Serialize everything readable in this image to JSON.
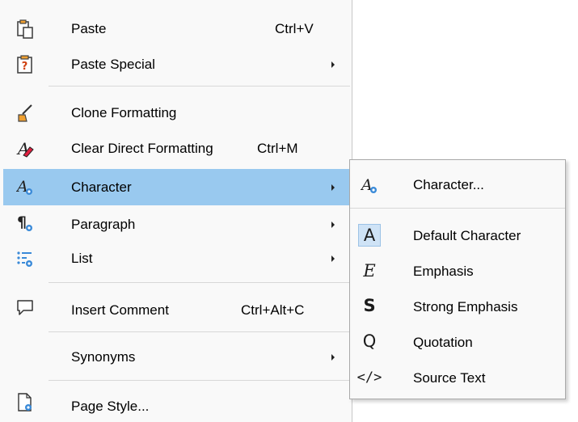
{
  "context_menu": {
    "items": [
      {
        "label": "Paste",
        "shortcut": "Ctrl+V",
        "icon": "paste-icon"
      },
      {
        "label": "Paste Special",
        "icon": "paste-special-icon"
      },
      {
        "label": "Clone Formatting",
        "icon": "clone-formatting-icon"
      },
      {
        "label": "Clear Direct Formatting",
        "shortcut": "Ctrl+M",
        "icon": "clear-formatting-icon"
      },
      {
        "label": "Character",
        "icon": "character-icon"
      },
      {
        "label": "Paragraph",
        "icon": "paragraph-icon"
      },
      {
        "label": "List",
        "icon": "list-icon"
      },
      {
        "label": "Insert Comment",
        "shortcut": "Ctrl+Alt+C",
        "icon": "comment-icon"
      },
      {
        "label": "Synonyms"
      },
      {
        "label": "Page Style...",
        "icon": "page-style-icon"
      }
    ],
    "highlight_color": "#99c9ef"
  },
  "submenu": {
    "items": [
      {
        "label": "Character...",
        "icon": "character-dialog-icon"
      },
      {
        "label": "Default Character",
        "glyph": "A",
        "icon": "default-character-icon"
      },
      {
        "label": "Emphasis",
        "glyph": "E",
        "icon": "emphasis-icon"
      },
      {
        "label": "Strong Emphasis",
        "glyph": "S",
        "icon": "strong-emphasis-icon"
      },
      {
        "label": "Quotation",
        "glyph": "Q",
        "icon": "quotation-icon"
      },
      {
        "label": "Source Text",
        "glyph": "</>",
        "icon": "source-text-icon"
      }
    ]
  }
}
